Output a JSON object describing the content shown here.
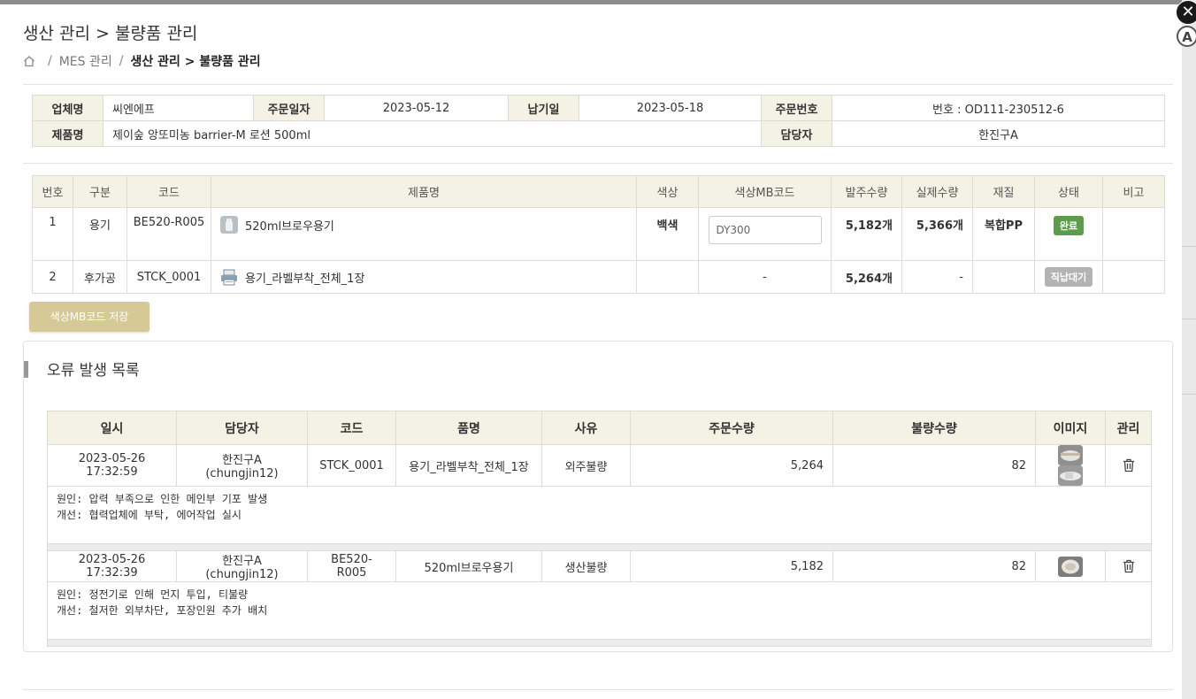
{
  "window": {
    "close_glyph": "✕",
    "a_badge": "A"
  },
  "header": {
    "title": "생산 관리 > 불량품 관리",
    "breadcrumb": {
      "home_icon": "home-icon",
      "item1": "MES 관리",
      "sep": "/",
      "current": "생산 관리 > 불량품 관리"
    }
  },
  "info": {
    "company_label": "업체명",
    "company": "씨엔에프",
    "order_date_label": "주문일자",
    "order_date": "2023-05-12",
    "due_label": "납기일",
    "due": "2023-05-18",
    "order_no_label": "주문번호",
    "order_no": "번호 : OD111-230512-6",
    "product_label": "제품명",
    "product": "제이숲 앙또미농 barrier-M 로션 500ml",
    "manager_label": "담당자",
    "manager": "한진구A"
  },
  "items": {
    "headers": [
      "번호",
      "구분",
      "코드",
      "제품명",
      "색상",
      "색상MB코드",
      "발주수량",
      "실제수량",
      "재질",
      "상태",
      "비고"
    ],
    "rows": [
      {
        "no": "1",
        "type": "용기",
        "code": "BE520-R005",
        "name": "520ml브로우용기",
        "color": "백색",
        "mb_code": "DY300",
        "order_qty": "5,182개",
        "actual_qty": "5,366개",
        "material": "복합PP",
        "status": "완료",
        "note": ""
      },
      {
        "no": "2",
        "type": "후가공",
        "code": "STCK_0001",
        "name": "용기_라벨부착_전체_1장",
        "color": "",
        "mb_code": "-",
        "order_qty": "5,264개",
        "actual_qty": "-",
        "material": "",
        "status": "직납대기",
        "note": ""
      }
    ]
  },
  "save_button": "색상MB코드 저장",
  "errors": {
    "title": "오류 발생 목록",
    "headers": [
      "일시",
      "담당자",
      "코드",
      "품명",
      "사유",
      "주문수량",
      "불량수량",
      "이미지",
      "관리"
    ],
    "rows": [
      {
        "datetime": "2023-05-26 17:32:59",
        "manager": "한진구A (chungjin12)",
        "code": "STCK_0001",
        "name": "용기_라벨부착_전체_1장",
        "reason": "외주불량",
        "order_qty": "5,264",
        "defect_qty": "82",
        "cause": "원인: 압력 부족으로 인한 메인부 기포 발생",
        "fix": "개선: 협력업체에 부탁, 에어작업 실시"
      },
      {
        "datetime": "2023-05-26 17:32:39",
        "manager": "한진구A (chungjin12)",
        "code": "BE520-R005",
        "name": "520ml브로우용기",
        "reason": "생산불량",
        "order_qty": "5,182",
        "defect_qty": "82",
        "cause": "원인: 정전기로 인해 먼지 투입, 티불량",
        "fix": "개선: 철저한 외부차단, 포장인원 추가 배치"
      }
    ]
  },
  "colors": {
    "status_done": "#5e9b4f",
    "status_wait": "#b3b3b3",
    "label_bg": "#f3f2e4",
    "save_btn": "#d5c995"
  }
}
